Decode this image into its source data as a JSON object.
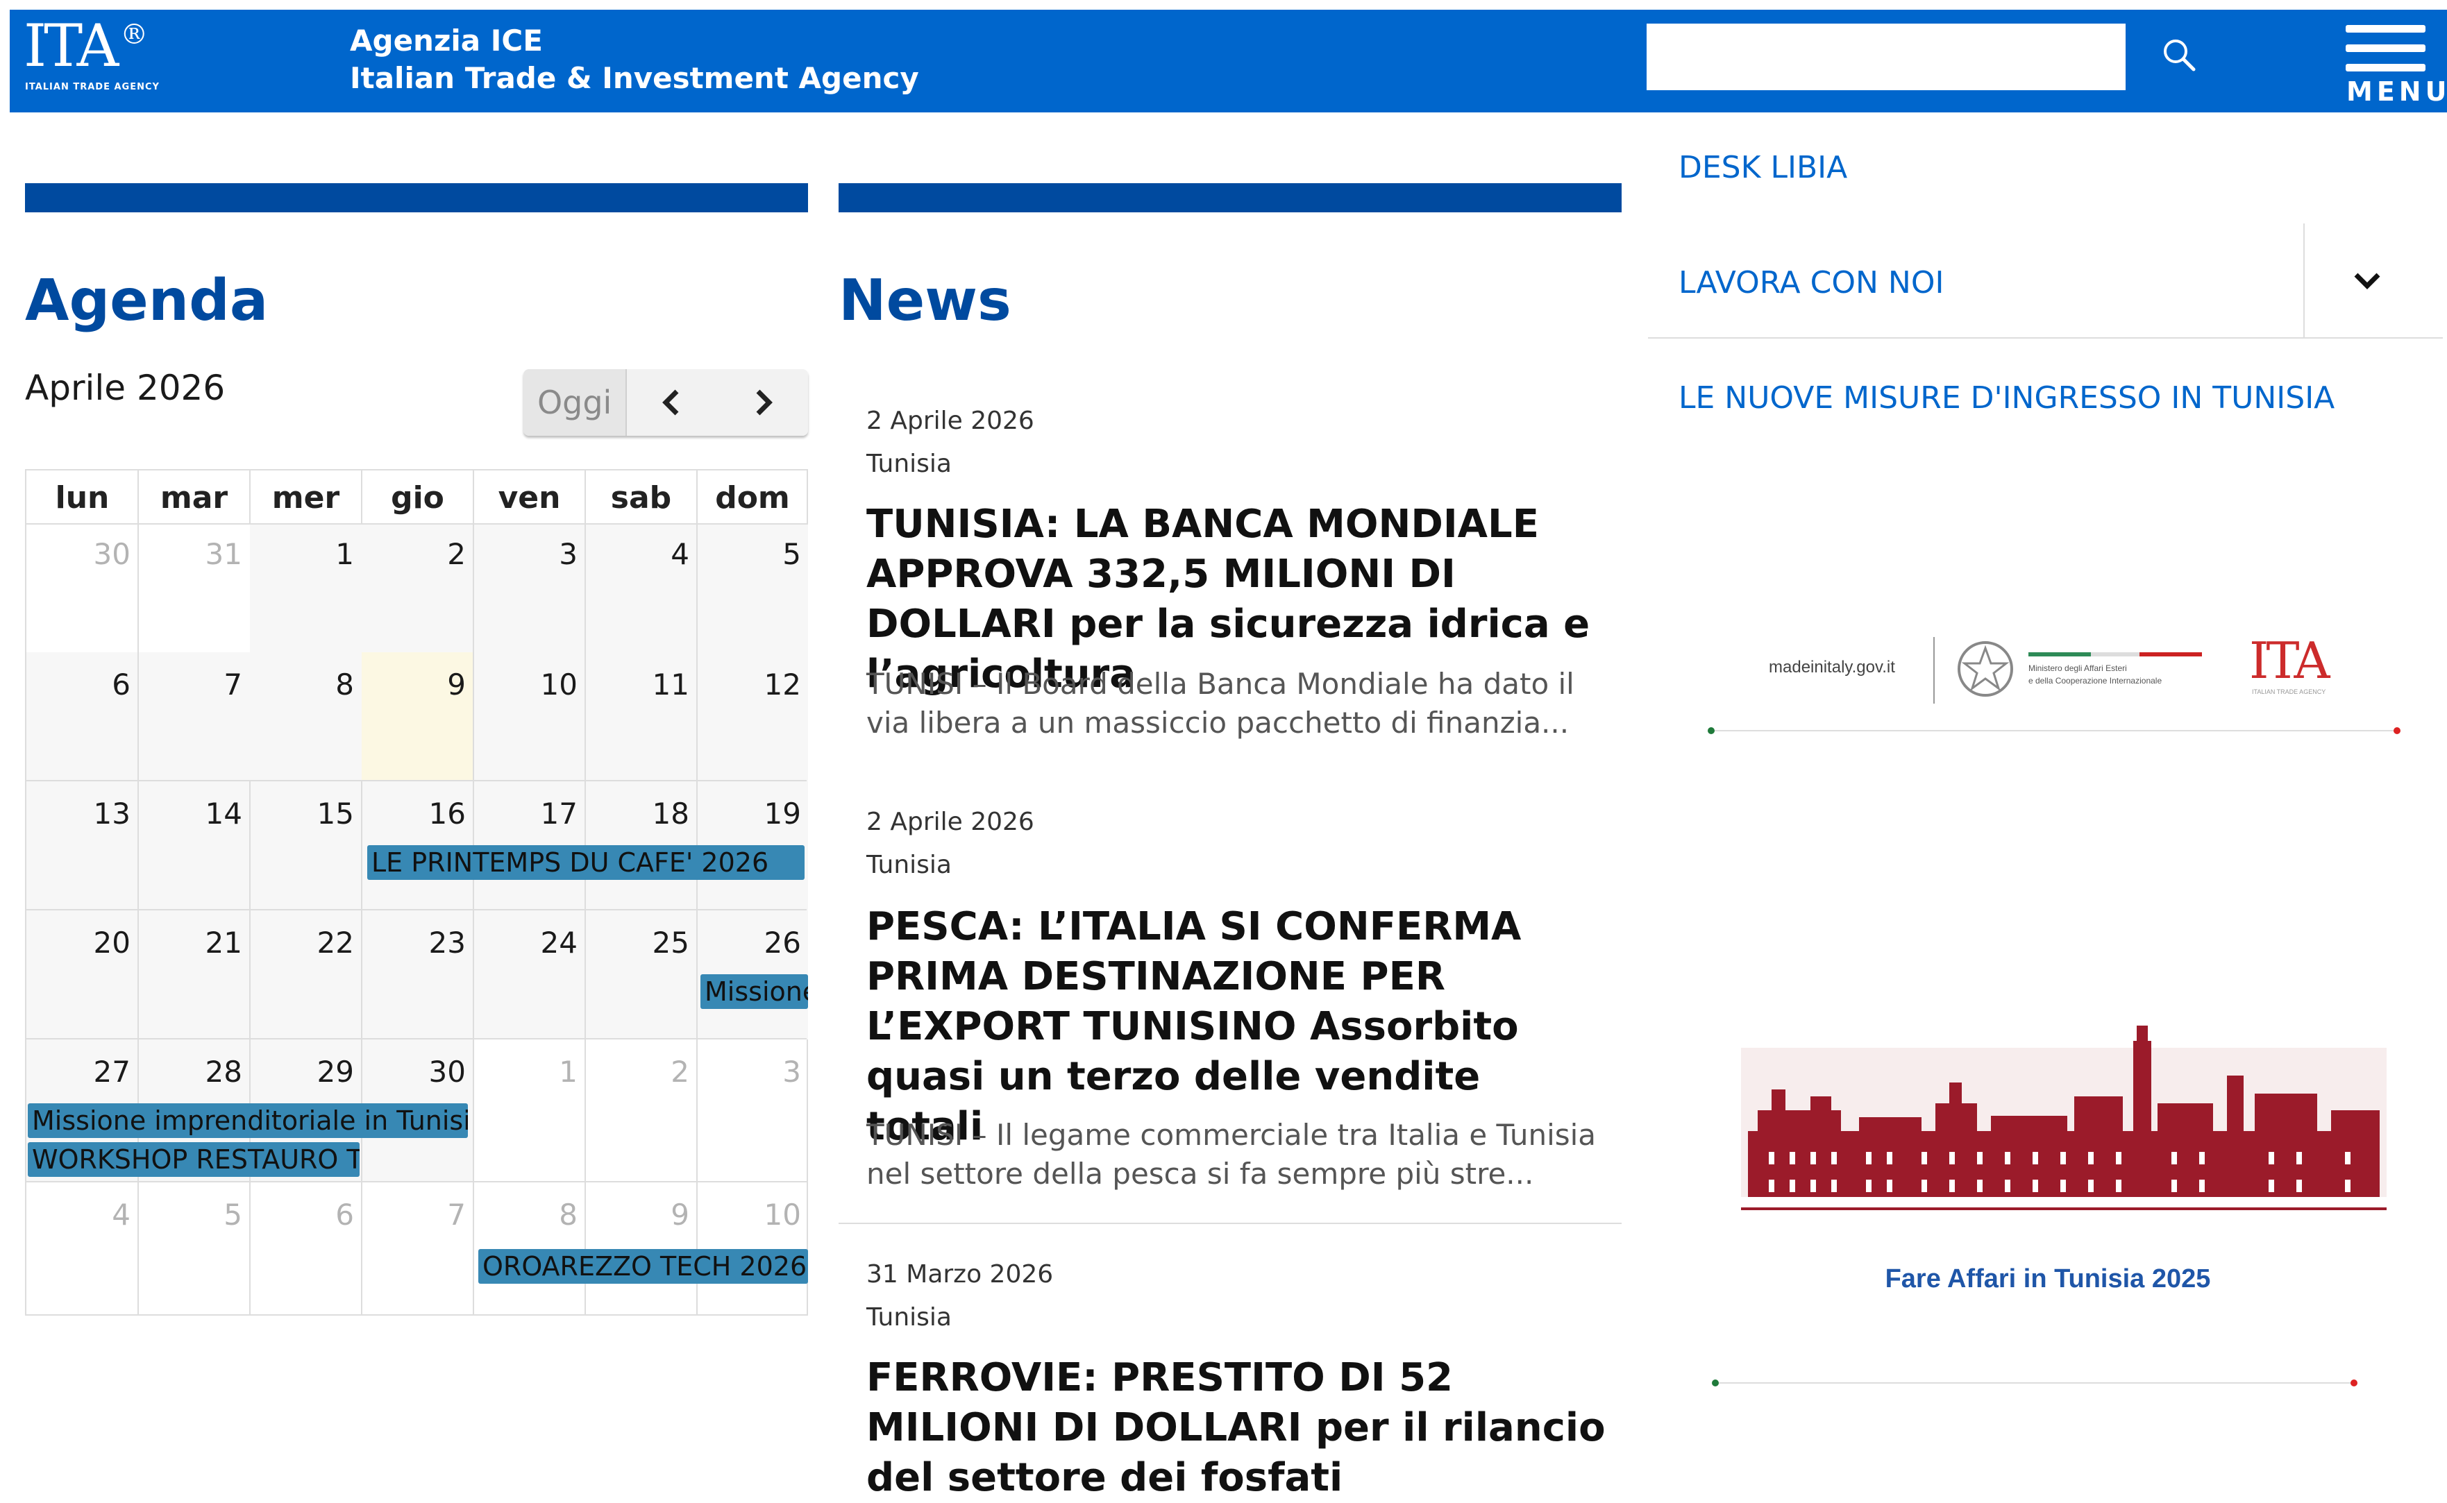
{
  "header": {
    "logo_text": "ITA",
    "logo_mark": "®",
    "logo_subtext": "ITALIAN TRADE AGENCY",
    "agency_line1": "Agenzia ICE",
    "agency_line2": "Italian Trade & Investment Agency",
    "search_placeholder": "",
    "menu_label": "MENU",
    "color": "#0066cc"
  },
  "agenda": {
    "title": "Agenda",
    "month": "Aprile 2026",
    "today_label": "Oggi",
    "prev_icon": "chevron-left-icon",
    "next_icon": "chevron-right-icon",
    "weekdays": [
      "lun",
      "mar",
      "mer",
      "gio",
      "ven",
      "sab",
      "dom"
    ],
    "weeks": [
      [
        "30",
        "31",
        "1",
        "2",
        "3",
        "4",
        "5"
      ],
      [
        "6",
        "7",
        "8",
        "9",
        "10",
        "11",
        "12"
      ],
      [
        "13",
        "14",
        "15",
        "16",
        "17",
        "18",
        "19"
      ],
      [
        "20",
        "21",
        "22",
        "23",
        "24",
        "25",
        "26"
      ],
      [
        "27",
        "28",
        "29",
        "30",
        "1",
        "2",
        "3"
      ],
      [
        "4",
        "5",
        "6",
        "7",
        "8",
        "9",
        "10"
      ]
    ],
    "today": "9",
    "events": [
      {
        "label": "LE PRINTEMPS DU CAFE' 2026"
      },
      {
        "label": "Missione imprenditoriale in Tunisia - ..."
      },
      {
        "label": "Missione imprenditoriale in Tunisia -"
      },
      {
        "label": "WORKSHOP RESTAURO TU"
      },
      {
        "label": "OROAREZZO TECH 2026"
      }
    ],
    "event_color": "#3788b4",
    "today_color": "#fcf8e3"
  },
  "news": {
    "title": "News",
    "items": [
      {
        "date": "2 Aprile 2026",
        "category": "Tunisia",
        "title_upper": "TUNISIA: LA BANCA MONDIALE APPROVA 332,5 MILIONI DI DOLLARI",
        "title_rest": "per la sicurezza idrica e l’agricoltura",
        "excerpt": "TUNISI – Il Board della Banca Mondiale ha dato il via libera a un massiccio pacchetto di finanzia..."
      },
      {
        "date": "2 Aprile 2026",
        "category": "Tunisia",
        "title_upper": "PESCA: L’ITALIA SI CONFERMA PRIMA DESTINAZIONE PER L’EXPORT TUNISINO",
        "title_rest": "Assorbito quasi un terzo delle vendite totali",
        "excerpt": "TUNISI – Il legame commerciale tra Italia e Tunisia nel settore della pesca si fa sempre più stre..."
      },
      {
        "date": "31 Marzo 2026",
        "category": "Tunisia",
        "title_upper": "FERROVIE: PRESTITO DI 52 MILIONI DI DOLLARI",
        "title_rest": "per il rilancio del settore dei fosfati",
        "excerpt": ""
      }
    ]
  },
  "sidebar": {
    "links": [
      "DESK LIBIA",
      "LAVORA CON NOI",
      "LE NUOVE MISURE D'INGRESSO IN TUNISIA"
    ],
    "banner1": {
      "site": "madeinitaly.gov.it",
      "ministry_line1": "Ministero degli Affari Esteri",
      "ministry_line2": "e della Cooperazione Internazionale",
      "logo": "ITA",
      "logo_sub": "ITALIAN TRADE AGENCY"
    },
    "banner2": {
      "caption": "Fare Affari in Tunisia 2025",
      "color": "#9b1b2a"
    }
  }
}
